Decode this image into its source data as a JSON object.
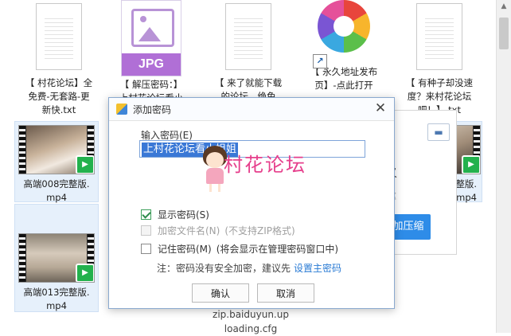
{
  "files": [
    {
      "name": "【 村花论坛】全\n免费-无套路-更\n新快.txt",
      "type": "txt"
    },
    {
      "name": "【 解压密码：】\n上村花论坛看小",
      "type": "jpg",
      "label": "JPG"
    },
    {
      "name": "【 来了就能下载\n的论坛，绝免",
      "type": "txt"
    },
    {
      "name": "【 永久地址发布\n页】-点此打开",
      "type": "url"
    },
    {
      "name": "【 有种子却没速\n度？来村花论坛\n吧！】.txt",
      "type": "txt"
    },
    {
      "name": "高端008完整版.\nmp4",
      "type": "video"
    },
    {
      "name": "2完整版.\nmp4",
      "type": "video"
    },
    {
      "name": "高端013完整版.\nmp4",
      "type": "video"
    }
  ],
  "background_panel": {
    "text1": "义",
    "text2": "率",
    "button": "加压缩"
  },
  "hidden_text": "zip.baiduyun.up\nloading.cfg",
  "dialog": {
    "title": "添加密码",
    "input_label": "输入密码(E)",
    "password_value": "上村花论坛看小姐姐",
    "watermark": "村花论坛",
    "options": [
      {
        "label": "显示密码(S)",
        "checked": true,
        "disabled": false,
        "extra": ""
      },
      {
        "label": "加密文件名(N)",
        "checked": false,
        "disabled": true,
        "extra": "(不支持ZIP格式)"
      },
      {
        "label": "记住密码(M)",
        "checked": false,
        "disabled": false,
        "extra": "(将会显示在管理密码窗口中)"
      }
    ],
    "note": "注：密码没有安全加密，建议先",
    "note_link": "设置主密码",
    "ok": "确认",
    "cancel": "取消"
  },
  "colors": {
    "accent": "#2e8ce8",
    "watermark": "#e63f8c",
    "jpg": "#b06fd6",
    "video_badge": "#23b14d"
  }
}
